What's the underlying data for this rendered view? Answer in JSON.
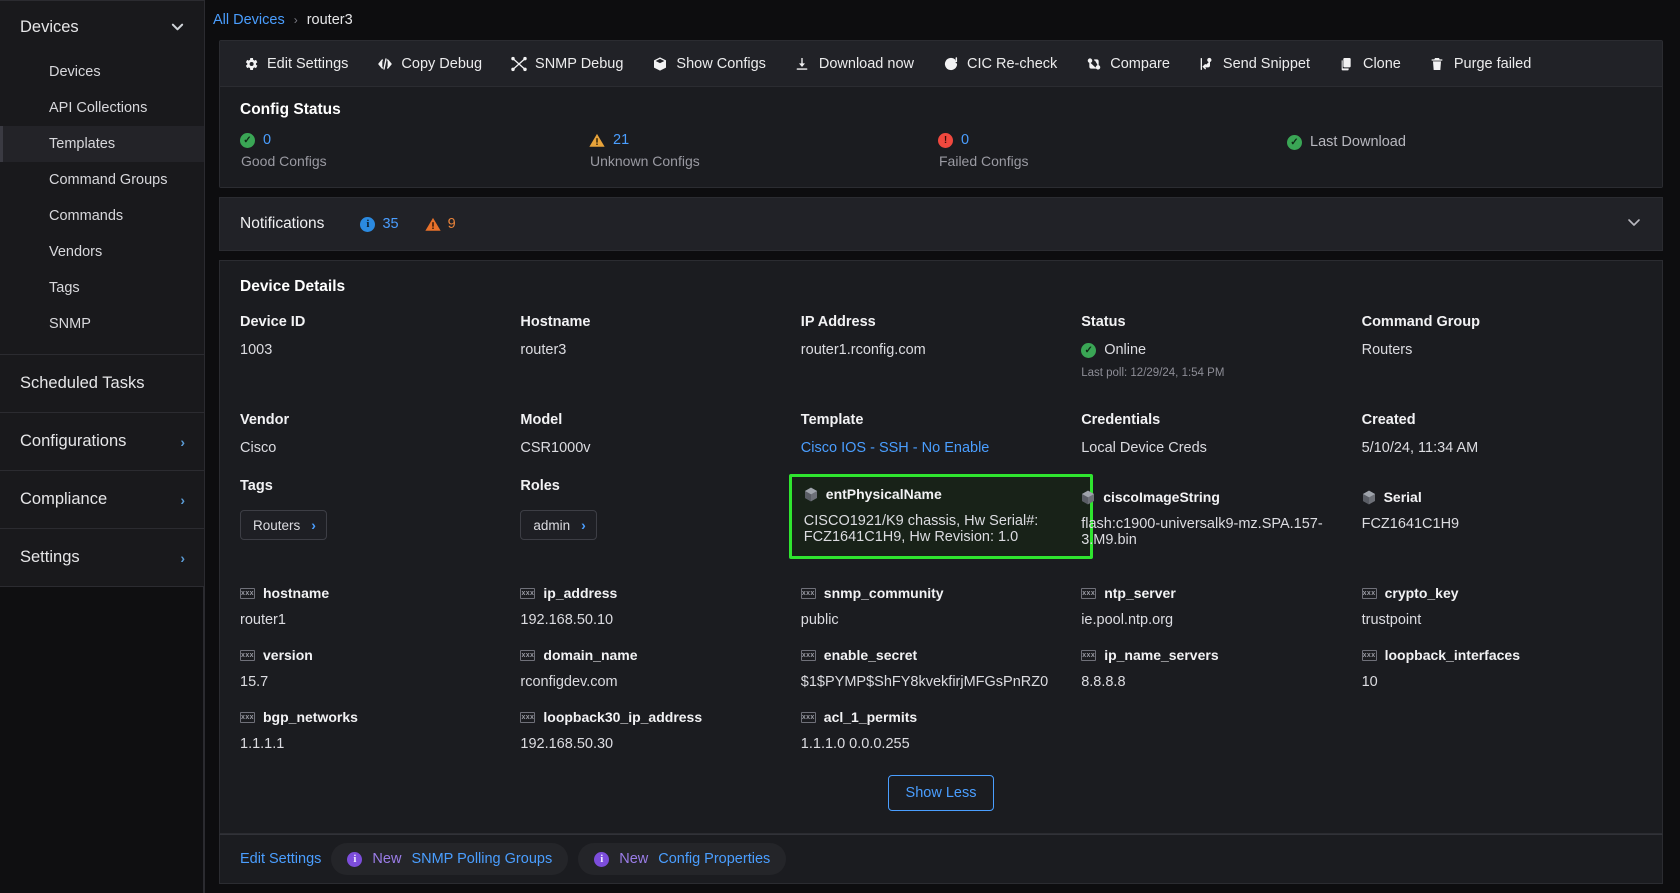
{
  "sidebar": {
    "group": {
      "label": "Devices",
      "icon": "chevron-down-icon"
    },
    "items": [
      {
        "label": "Devices"
      },
      {
        "label": "API Collections"
      },
      {
        "label": "Templates"
      },
      {
        "label": "Command Groups"
      },
      {
        "label": "Commands"
      },
      {
        "label": "Vendors"
      },
      {
        "label": "Tags"
      },
      {
        "label": "SNMP"
      }
    ],
    "rows": [
      {
        "label": "Scheduled Tasks",
        "chevron": ""
      },
      {
        "label": "Configurations",
        "chevron": "›"
      },
      {
        "label": "Compliance",
        "chevron": "›"
      },
      {
        "label": "Settings",
        "chevron": "›"
      }
    ]
  },
  "breadcrumb": {
    "root": "All Devices",
    "separator": "›",
    "current": "router3"
  },
  "toolbar": {
    "buttons": [
      {
        "label": "Edit Settings",
        "icon": "gear-icon"
      },
      {
        "label": "Copy Debug",
        "icon": "code-icon"
      },
      {
        "label": "SNMP Debug",
        "icon": "network-icon"
      },
      {
        "label": "Show Configs",
        "icon": "box-icon"
      },
      {
        "label": "Download now",
        "icon": "download-icon"
      },
      {
        "label": "CIC Re-check",
        "icon": "refresh-icon"
      },
      {
        "label": "Compare",
        "icon": "compare-icon"
      },
      {
        "label": "Send Snippet",
        "icon": "snippet-icon"
      },
      {
        "label": "Clone",
        "icon": "copy-icon"
      },
      {
        "label": "Purge failed",
        "icon": "trash-icon"
      }
    ]
  },
  "config_status": {
    "title": "Config Status",
    "cells": [
      {
        "count": "0",
        "label": "Good Configs",
        "icon": "check-circle-icon",
        "state": "good"
      },
      {
        "count": "21",
        "label": "Unknown Configs",
        "icon": "warning-triangle-icon",
        "state": "unknown"
      },
      {
        "count": "0",
        "label": "Failed Configs",
        "icon": "error-circle-icon",
        "state": "failed"
      }
    ],
    "last_download": {
      "label": "Last Download",
      "icon": "check-circle-icon"
    }
  },
  "notifications": {
    "title": "Notifications",
    "info_count": "35",
    "warn_count": "9",
    "caret": "⌄"
  },
  "details": {
    "title": "Device Details",
    "row1": [
      {
        "label": "Device ID",
        "value": "1003"
      },
      {
        "label": "Hostname",
        "value": "router3"
      },
      {
        "label": "IP Address",
        "value": "router1.rconfig.com"
      },
      {
        "label": "Status",
        "value": "Online",
        "sub": "Last poll: 12/29/24, 1:54 PM"
      },
      {
        "label": "Command Group",
        "value": "Routers"
      }
    ],
    "row2": [
      {
        "label": "Vendor",
        "value": "Cisco"
      },
      {
        "label": "Model",
        "value": "CSR1000v"
      },
      {
        "label": "Template",
        "value": "Cisco IOS - SSH - No Enable"
      },
      {
        "label": "Credentials",
        "value": "Local Device Creds"
      },
      {
        "label": "Created",
        "value": "5/10/24, 11:34 AM"
      }
    ],
    "tags": {
      "label": "Tags",
      "chips": [
        "Routers"
      ]
    },
    "roles": {
      "label": "Roles",
      "chips": [
        "admin"
      ]
    },
    "snmp": [
      {
        "label": "entPhysicalName",
        "value": "CISCO1921/K9 chassis, Hw Serial#: FCZ1641C1H9, Hw Revision: 1.0",
        "highlighted": true
      },
      {
        "label": "ciscoImageString",
        "value": "flash:c1900-universalk9-mz.SPA.157-3.M9.bin",
        "highlighted": false
      },
      {
        "label": "Serial",
        "value": "FCZ1641C1H9",
        "highlighted": false
      }
    ],
    "properties": [
      {
        "label": "hostname",
        "value": "router1"
      },
      {
        "label": "ip_address",
        "value": "192.168.50.10"
      },
      {
        "label": "snmp_community",
        "value": "public"
      },
      {
        "label": "ntp_server",
        "value": "ie.pool.ntp.org"
      },
      {
        "label": "crypto_key",
        "value": "trustpoint"
      },
      {
        "label": "version",
        "value": "15.7"
      },
      {
        "label": "domain_name",
        "value": "rconfigdev.com"
      },
      {
        "label": "enable_secret",
        "value": "$1$PYMP$ShFY8kvekfirjMFGsPnRZ0"
      },
      {
        "label": "ip_name_servers",
        "value": "8.8.8.8"
      },
      {
        "label": "loopback_interfaces",
        "value": "10"
      },
      {
        "label": "bgp_networks",
        "value": "1.1.1.1"
      },
      {
        "label": "loopback30_ip_address",
        "value": "192.168.50.30"
      },
      {
        "label": "acl_1_permits",
        "value": "1.1.1.0 0.0.0.255"
      },
      {
        "label": "",
        "value": ""
      },
      {
        "label": "",
        "value": ""
      }
    ],
    "show_less": "Show Less"
  },
  "footer": {
    "edit_settings": "Edit Settings",
    "pills": [
      {
        "new": "New",
        "label": "SNMP Polling Groups"
      },
      {
        "new": "New",
        "label": "Config Properties"
      }
    ]
  },
  "colors": {
    "accent_blue": "#4a9eff",
    "good_green": "#3aa655",
    "warn_orange": "#e8a33a",
    "fail_red": "#f0483e",
    "highlight_green": "#2fe52f",
    "purple": "#9b7de8"
  },
  "icon_glyphs": {
    "var_icon_text": "xxx"
  }
}
